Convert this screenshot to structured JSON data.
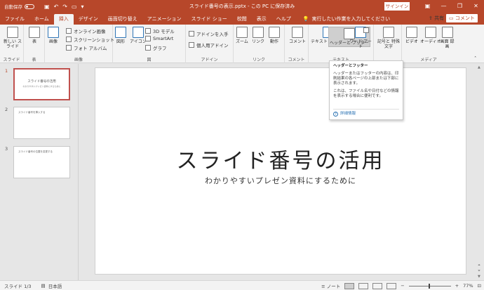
{
  "titlebar": {
    "autosave_label": "自動保存",
    "autosave_state": "オフ",
    "title": "スライド番号の表示.pptx - この PC に保存済み",
    "signin_label": "サインイン",
    "qat_icons": [
      "save-icon",
      "undo-icon",
      "redo-icon",
      "present-icon",
      "customize-icon"
    ]
  },
  "tabs": [
    "ファイル",
    "ホーム",
    "挿入",
    "デザイン",
    "画面切り替え",
    "アニメーション",
    "スライド ショー",
    "校閲",
    "表示",
    "ヘルプ"
  ],
  "active_tab": "挿入",
  "tellme": "実行したい作業を入力してください",
  "share_label": "共有",
  "comment_label": "コメント",
  "ribbon": {
    "groups": {
      "slide": "スライド",
      "table": "表",
      "images": "画像",
      "illustrations": "図",
      "addins": "アドイン",
      "links": "リンク",
      "comments": "コメント",
      "text": "テキスト",
      "symbols": "記号と特殊文字",
      "media": "メディア"
    },
    "buttons": {
      "new_slide": "新しい スライド",
      "table": "表",
      "picture": "画像",
      "online_picture": "オンライン画像",
      "screenshot": "スクリーンショット",
      "photo_album": "フォト アルバム",
      "shapes": "図形",
      "icons": "アイコン",
      "model3d": "3D モデル",
      "smartart": "SmartArt",
      "chart": "グラフ",
      "get_addins": "アドインを入手",
      "my_addins": "個人用アドイン",
      "zoom": "ズーム",
      "link": "リンク",
      "action": "動作",
      "comment": "コメント",
      "textbox": "テキスト ボックス",
      "header_footer": "ヘッダーと フッター",
      "wordart": "ワード アート",
      "symbols": "記号と 特殊文字",
      "video": "ビデオ",
      "audio": "オーディオ",
      "screen_recording": "画面 録画"
    }
  },
  "tooltip": {
    "title": "ヘッダーとフッター",
    "body1": "ヘッダーまたはフッターの内容は、印刷結果の各ページの上部または下部に表示されます。",
    "body2": "これは、ファイル名や日付などの情報を表示する場合に便利です。",
    "link": "詳細情報"
  },
  "thumbnails": [
    {
      "num": "1",
      "title": "スライド番号の活用",
      "subtitle": "わかりやすいプレゼン資料にするために"
    },
    {
      "num": "2",
      "title": "スライド番号を挿入する"
    },
    {
      "num": "3",
      "title": "スライド番号の位置を変更する"
    }
  ],
  "slide": {
    "title": "スライド番号の活用",
    "subtitle": "わかりやすいプレゼン資料にするために"
  },
  "status": {
    "slide_info": "スライド 1/3",
    "language": "日本語",
    "notes": "ノート",
    "zoom": "77%"
  },
  "colors": {
    "accent": "#b7472a",
    "selected_thumb": "#c0504d"
  }
}
